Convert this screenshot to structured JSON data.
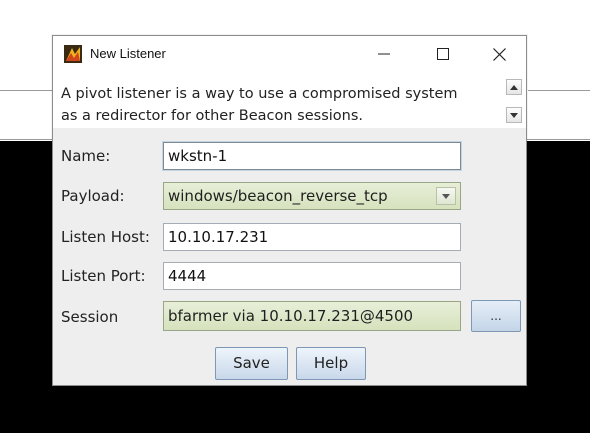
{
  "window": {
    "title": "New Listener",
    "minimize_icon": "minimize-icon",
    "maximize_icon": "maximize-icon",
    "close_icon": "close-icon"
  },
  "description": {
    "line1": "A pivot listener is a way to use a compromised system",
    "line2": "as a redirector for other Beacon sessions."
  },
  "form": {
    "name": {
      "label": "Name:",
      "value": "wkstn-1"
    },
    "payload": {
      "label": "Payload:",
      "value": "windows/beacon_reverse_tcp"
    },
    "listen_host": {
      "label": "Listen Host:",
      "value": "10.10.17.231"
    },
    "listen_port": {
      "label": "Listen Port:",
      "value": "4444"
    },
    "session": {
      "label": "Session",
      "value": "bfarmer via  10.10.17.231@4500",
      "browse_label": "..."
    }
  },
  "buttons": {
    "save": "Save",
    "help": "Help"
  },
  "colors": {
    "accent_green": "#d6e2bd",
    "button_blue": "#c8d8ea",
    "background_black": "#000000"
  }
}
